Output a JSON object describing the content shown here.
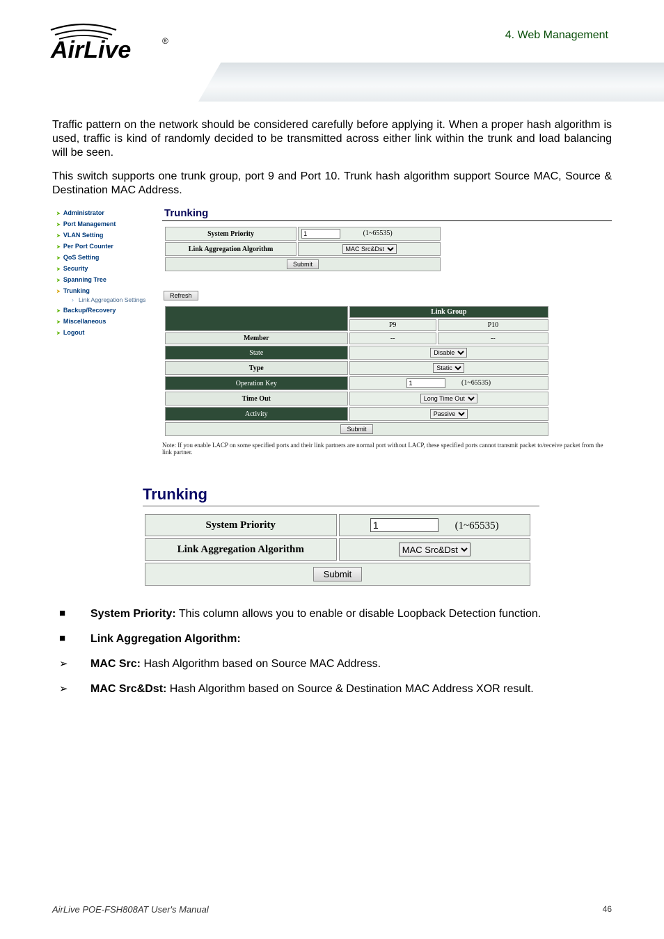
{
  "chapter": "4.  Web Management",
  "logo_text1": "Air",
  "logo_text2": "Live",
  "logo_reg": "®",
  "para1": "Traffic pattern on the network should be considered carefully before applying it. When a proper hash algorithm is used, traffic is kind of randomly decided to be transmitted across either link within the trunk and load balancing will be seen.",
  "para2": "This switch supports one trunk group, port 9 and Port 10. Trunk hash algorithm support Source MAC, Source & Destination MAC Address.",
  "nav": {
    "items": [
      "Administrator",
      "Port Management",
      "VLAN Setting",
      "Per Port Counter",
      "QoS Setting",
      "Security",
      "Spanning Tree",
      "Trunking",
      "Backup/Recovery",
      "Miscellaneous",
      "Logout"
    ],
    "sub": "Link Aggregation Settings"
  },
  "panel": {
    "title": "Trunking",
    "syspri": "System Priority",
    "syspri_val": "1",
    "syspri_range": "(1~65535)",
    "linkagg": "Link Aggregation Algorithm",
    "linkagg_val": "MAC Src&Dst",
    "submit": "Submit",
    "refresh": "Refresh",
    "grid": {
      "linkgroup": "Link Group",
      "member": "Member",
      "p9": "P9",
      "p10": "P10",
      "dash": "--",
      "state": "State",
      "state_val": "Disable",
      "type": "Type",
      "type_val": "Static",
      "opkey": "Operation Key",
      "opkey_val": "1",
      "opkey_range": "(1~65535)",
      "timeout": "Time Out",
      "timeout_val": "Long Time Out",
      "activity": "Activity",
      "activity_val": "Passive",
      "submit2": "Submit"
    },
    "note": "Note: If you enable LACP on some specified ports and their link partners are normal port without LACP, these specified ports cannot transmit packet to/receive packet from the link partner."
  },
  "detail": {
    "title": "Trunking",
    "syspri": "System Priority",
    "syspri_val": "1",
    "syspri_range": "(1~65535)",
    "linkagg": "Link Aggregation Algorithm",
    "linkagg_val": "MAC Src&Dst",
    "submit": "Submit"
  },
  "bullets": {
    "b1_label": "System Priority:",
    "b1_text": " This column allows you to enable or disable Loopback Detection function.",
    "b2_label": "Link Aggregation Algorithm:",
    "b3_label": "MAC Src:",
    "b3_text": " Hash Algorithm based on Source MAC Address.",
    "b4_label": "MAC Src&Dst:",
    "b4_text": " Hash Algorithm based on Source & Destination MAC Address XOR result."
  },
  "footer": {
    "left": "AirLive POE-FSH808AT User's Manual",
    "page": "46"
  }
}
